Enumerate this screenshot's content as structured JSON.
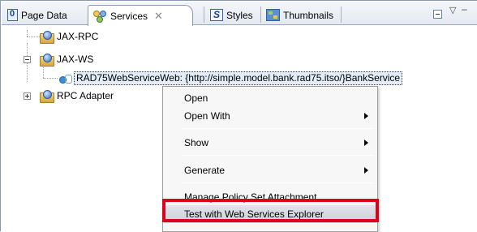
{
  "tabs": [
    {
      "label": "Page Data",
      "icon": "page-data-icon"
    },
    {
      "label": "Services",
      "icon": "services-icon",
      "close": "✕"
    },
    {
      "label": "Styles",
      "icon": "styles-icon"
    },
    {
      "label": "Thumbnails",
      "icon": "thumbnails-icon"
    }
  ],
  "view_controls": {
    "menu_glyph": "▽",
    "minimize_glyph": "–"
  },
  "tree": {
    "jax_rpc": "JAX-RPC",
    "jax_ws": "JAX-WS",
    "service": "RAD75WebServiceWeb: {http://simple.model.bank.rad75.itso/}BankService",
    "rpc_adapter": "RPC Adapter"
  },
  "menu": {
    "items": [
      {
        "label": "Open"
      },
      {
        "label": "Open With"
      },
      {
        "label": "Show"
      },
      {
        "label": "Generate"
      },
      {
        "label": "Manage Policy Set Attachment ..."
      },
      {
        "label": "Test with Web Services Explorer"
      }
    ]
  },
  "highlight_color": "#e0001b"
}
